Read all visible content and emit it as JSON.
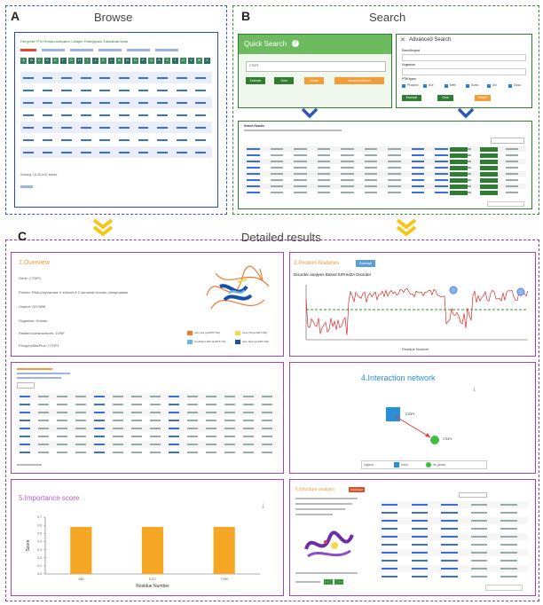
{
  "panels": {
    "a": {
      "letter": "A",
      "title": "Browse"
    },
    "b": {
      "letter": "B",
      "title": "Search"
    },
    "c": {
      "letter": "C",
      "title": "Detailed results"
    }
  },
  "browse": {
    "filter_line": "Free genes: PTM; Phospho-Acetylation; Collagen; Proteoglycans; Extracellular Space",
    "letters": [
      "A",
      "B",
      "C",
      "D",
      "E",
      "F",
      "G",
      "H",
      "I",
      "J",
      "K",
      "L",
      "M",
      "N",
      "O",
      "P",
      "Q",
      "R",
      "S",
      "T",
      "U",
      "V",
      "W",
      "X",
      "Y",
      "Z"
    ],
    "footer": "Showing 1 to 25 of 67 entries"
  },
  "search": {
    "quick_title": "Quick Search",
    "quick_value": "CTDP1",
    "quick_buttons": [
      "Example",
      "Clear",
      "Search",
      "Advanced Search"
    ],
    "advanced_title": "Advanced Search",
    "adv_gene_label": "Gene/Uniprot",
    "adv_organism_label": "Organism",
    "adv_ptm_label": "PTM types",
    "adv_checks": [
      "Phospho",
      "Ace",
      "Meth",
      "Sumo",
      "Ubi",
      "Glyco"
    ],
    "adv_buttons": [
      "Example",
      "Clear",
      "Search"
    ],
    "results_title": "Search Results"
  },
  "overview": {
    "title": "1.Overview",
    "gene": "Gene: CTDP1",
    "protein": "Protein: RNA polymerase II subunit A C-terminal domain phosphatase",
    "uniprot": "Uniprot: Q9Y5B0",
    "organism": "Organism: Human",
    "db1": "Related substructures: 1ONF",
    "db2": "PhosphoSitePlus: CTDP1",
    "legend": [
      {
        "label": "Very low (pLDDT<50)",
        "color": "#f07a2c"
      },
      {
        "label": "Low (70>pLDDT>50)",
        "color": "#f5d94a"
      },
      {
        "label": "Confident (90>pLDDT>70)",
        "color": "#66b6e6"
      },
      {
        "label": "Very high (pLDDT>90)",
        "color": "#1a4fa8"
      }
    ]
  },
  "features": {
    "title": "2.Protein features",
    "button": "Download",
    "subtitle": "Disorder analysis Based IUPred2A Disorder",
    "xlabel": "Residue Number"
  },
  "network": {
    "title": "4.Interaction network",
    "node1": "CTDP1",
    "node2": "CTDP1",
    "legend_label": "Legend",
    "legend_gene": "Gene",
    "legend_int": "Int_genes"
  },
  "importance": {
    "title": "5.Importance score",
    "xlabel": "Residue Number",
    "ylabel": "Score"
  },
  "structure": {
    "title": "6.Structure analysis",
    "button": "Download"
  },
  "chart_data": {
    "type": "bar",
    "categories": [
      "S66",
      "S107",
      "T159"
    ],
    "values": [
      0.58,
      0.58,
      0.58
    ],
    "xlabel": "Residue Number",
    "ylabel": "Score",
    "ylim": [
      0,
      0.7
    ]
  }
}
